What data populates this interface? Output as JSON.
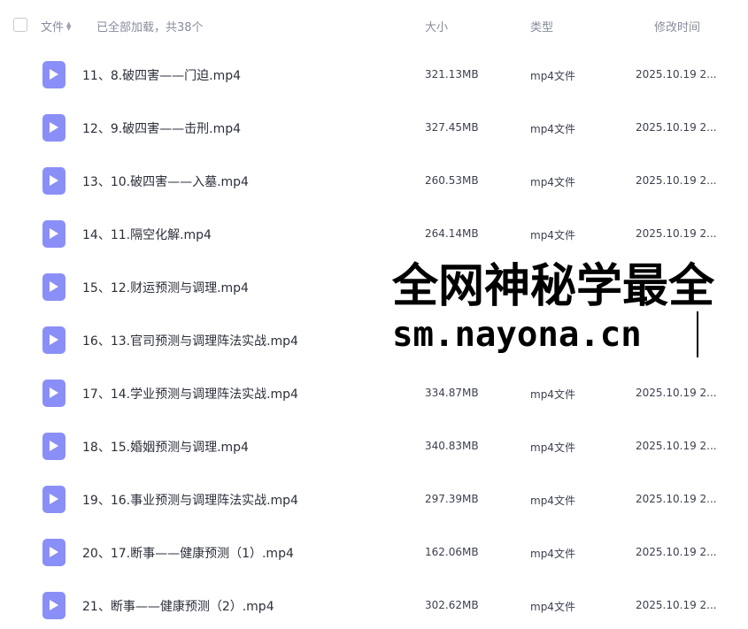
{
  "header": {
    "name_label": "文件",
    "loaded_text": "已全部加载，共38个",
    "size_label": "大小",
    "type_label": "类型",
    "time_label": "修改时间"
  },
  "files": [
    {
      "name": "11、8.破四害——门迫.mp4",
      "size": "321.13MB",
      "type": "mp4文件",
      "time": "2025.10.19 2..."
    },
    {
      "name": "12、9.破四害——击刑.mp4",
      "size": "327.45MB",
      "type": "mp4文件",
      "time": "2025.10.19 2..."
    },
    {
      "name": "13、10.破四害——入墓.mp4",
      "size": "260.53MB",
      "type": "mp4文件",
      "time": "2025.10.19 2..."
    },
    {
      "name": "14、11.隔空化解.mp4",
      "size": "264.14MB",
      "type": "mp4文件",
      "time": "2025.10.19 2..."
    },
    {
      "name": "15、12.财运预测与调理.mp4",
      "size": "",
      "type": "",
      "time": ""
    },
    {
      "name": "16、13.官司预测与调理阵法实战.mp4",
      "size": "",
      "type": "",
      "time": ""
    },
    {
      "name": "17、14.学业预测与调理阵法实战.mp4",
      "size": "334.87MB",
      "type": "mp4文件",
      "time": "2025.10.19 2..."
    },
    {
      "name": "18、15.婚姻预测与调理.mp4",
      "size": "340.83MB",
      "type": "mp4文件",
      "time": "2025.10.19 2..."
    },
    {
      "name": "19、16.事业预测与调理阵法实战.mp4",
      "size": "297.39MB",
      "type": "mp4文件",
      "time": "2025.10.19 2..."
    },
    {
      "name": "20、17.断事——健康预测（1）.mp4",
      "size": "162.06MB",
      "type": "mp4文件",
      "time": "2025.10.19 2..."
    },
    {
      "name": "21、断事——健康预测（2）.mp4",
      "size": "302.62MB",
      "type": "mp4文件",
      "time": "2025.10.19 2..."
    }
  ],
  "watermark": {
    "line1": "全网神秘学最全",
    "line2": "sm.nayona.cn"
  },
  "colors": {
    "file_icon": "#8a8ff7",
    "header_text": "#878c9c"
  }
}
